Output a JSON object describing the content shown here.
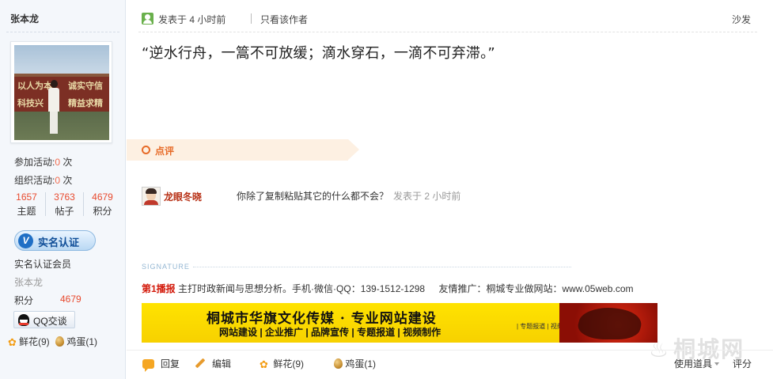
{
  "author": {
    "name": "张本龙",
    "avatar_text": [
      "以人为本",
      "诚实守信",
      "科技兴",
      "精益求精"
    ],
    "stats": [
      {
        "label": "参加活动:",
        "value": "0",
        "unit": "次"
      },
      {
        "label": "组织活动:",
        "value": "0",
        "unit": "次"
      }
    ],
    "counters": [
      {
        "value": "1657",
        "label": "主题"
      },
      {
        "value": "3763",
        "label": "帖子"
      },
      {
        "value": "4679",
        "label": "积分"
      }
    ],
    "verify_badge": "实名认证",
    "verify_badge_icon": "V",
    "verified_member": "实名认证会员",
    "display_name": "张本龙",
    "credit_label": "积分",
    "credit_value": "4679",
    "qq_button": "QQ交谈",
    "flowers": "鲜花(9)",
    "eggs": "鸡蛋(1)"
  },
  "post": {
    "posted": "发表于 4 小时前",
    "only_author": "只看该作者",
    "floor": "沙发",
    "body": "“逆水行舟，一篙不可放缓；滴水穿石，一滴不可弃滞。”"
  },
  "rating": {
    "label": "点评"
  },
  "comment": {
    "user": "龙眼冬晓",
    "text": "你除了复制粘贴其它的什么都不会？",
    "time": "发表于 2 小时前"
  },
  "signature": {
    "label": "SIGNATURE",
    "brand": "第1播报",
    "text": "主打时政新闻与思想分析。手机·微信·QQ：139-1512-1298",
    "promo": "友情推广：桐城专业做网站：www.05web.com",
    "banner_title": "桐城市华旗文化传媒 · 专业网站建设",
    "banner_subtitle": "网站建设 | 企业推广 | 品牌宣传 | 专题报道 | 视频制作",
    "banner_small": "| 专题报道 | 视频制作"
  },
  "watermark": "桐城网",
  "actions": {
    "reply": "回复",
    "edit": "编辑",
    "flowers": "鲜花(9)",
    "eggs": "鸡蛋(1)",
    "tools": "使用道具",
    "rate": "评分"
  },
  "colors": {
    "accent_red": "#e84a2e",
    "rating_orange": "#e76b28",
    "banner_yellow": "#ffe300",
    "sidebar_bg": "#f4f7fb"
  }
}
